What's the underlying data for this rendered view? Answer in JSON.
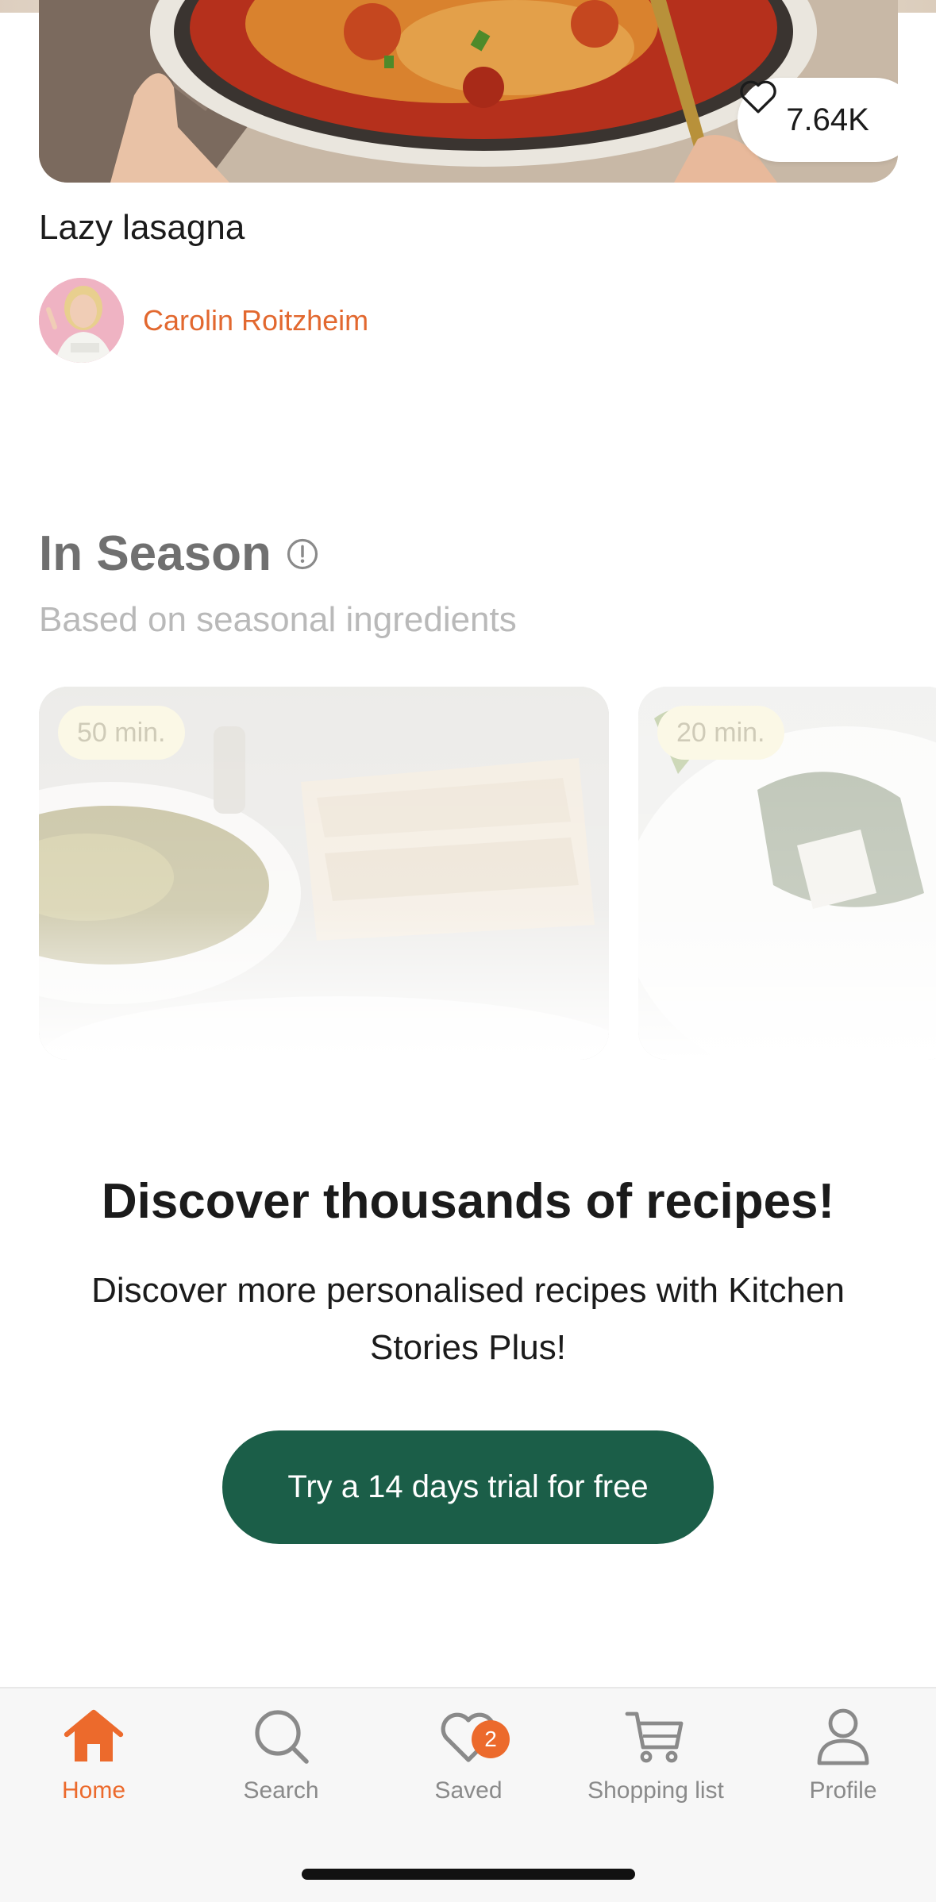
{
  "featured_recipe": {
    "likes": "7.64K",
    "title": "Lazy lasagna",
    "author": "Carolin Roitzheim"
  },
  "in_season": {
    "title": "In Season",
    "subtitle": "Based on seasonal ingredients",
    "cards": [
      {
        "time": "50 min."
      },
      {
        "time": "20 min."
      }
    ]
  },
  "promo": {
    "title": "Discover thousands of recipes!",
    "text": "Discover more personalised recipes with Kitchen Stories Plus!",
    "button_label": "Try a 14 days trial for free"
  },
  "tab_bar": {
    "items": [
      {
        "label": "Home",
        "icon": "home-icon",
        "active": true
      },
      {
        "label": "Search",
        "icon": "search-icon",
        "active": false
      },
      {
        "label": "Saved",
        "icon": "heart-icon",
        "active": false,
        "badge": "2"
      },
      {
        "label": "Shopping list",
        "icon": "cart-icon",
        "active": false
      },
      {
        "label": "Profile",
        "icon": "profile-icon",
        "active": false
      }
    ]
  },
  "colors": {
    "accent": "#ec6a2c",
    "author": "#e2682f",
    "primary_button": "#1b5e48"
  }
}
